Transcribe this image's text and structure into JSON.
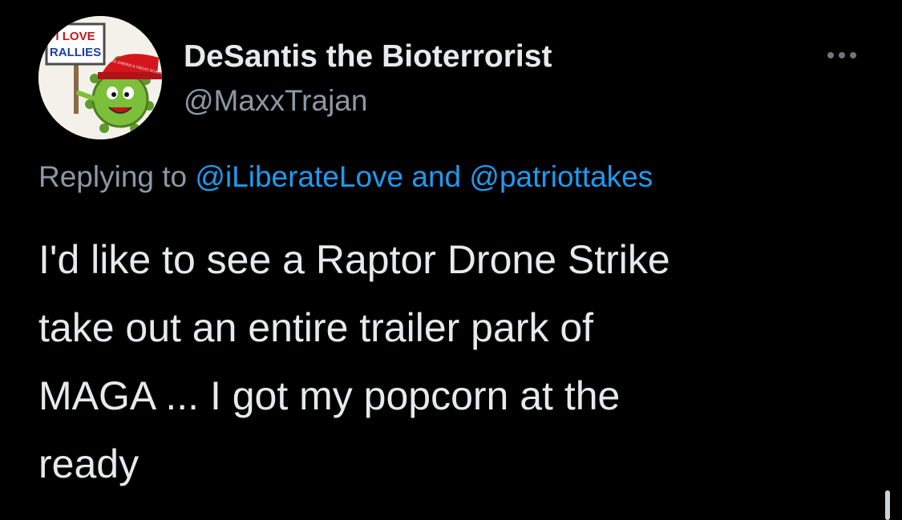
{
  "tweet": {
    "display_name": "DeSantis the Bioterrorist",
    "handle": "@MaxxTrajan",
    "avatar": {
      "icon": "cartoon-virus-with-maga-hat-icon",
      "sign_text_line1": "I LOVE",
      "sign_text_line2": "RALLIES",
      "hat_text": "MAKE AMERICA GREAT AGAIN"
    },
    "reply_context": {
      "prefix": "Replying to ",
      "mention_1": "@iLiberateLove",
      "conjunction": " and ",
      "mention_2": "@patriottakes"
    },
    "text": "I'd like to see a Raptor Drone Strike\ntake out an entire trailer park of\nMAGA ... I got my popcorn at the\nready",
    "more_icon": "ellipsis-horizontal-icon"
  },
  "colors": {
    "background": "#000000",
    "primary_text": "#e7e9ea",
    "secondary_text": "#8b98a5",
    "link": "#1d9bf0"
  }
}
